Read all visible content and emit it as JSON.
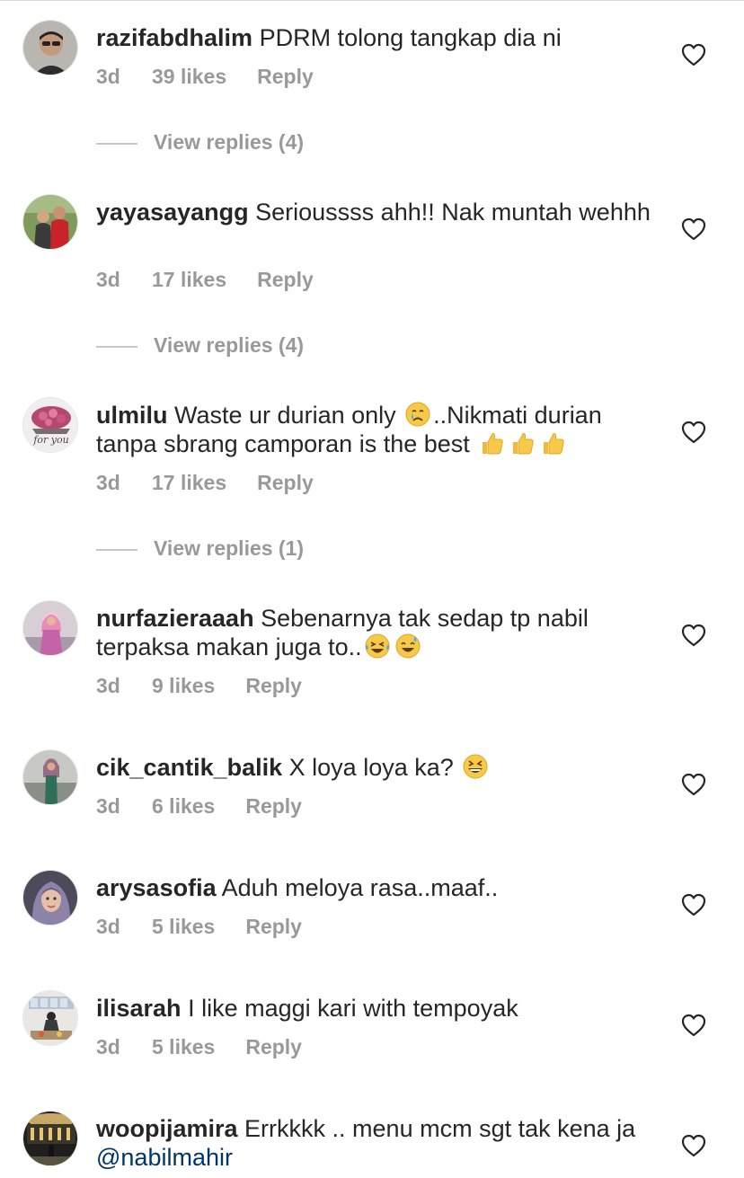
{
  "comments": [
    {
      "username": "razifabdhalim",
      "text": "PDRM tolong tangkap dia ni",
      "time": "3d",
      "likes": "39 likes",
      "reply": "Reply",
      "view_replies": "View replies (4)",
      "avatar": "avatar-man-glasses"
    },
    {
      "username": "yayasayangg",
      "text": "Serioussss ahh!! Nak muntah wehhh",
      "time": "3d",
      "likes": "17 likes",
      "reply": "Reply",
      "view_replies": "View replies (4)",
      "avatar": "avatar-couple"
    },
    {
      "username": "ulmilu",
      "text_part1": "Waste ur durian only",
      "text_part2": "..Nikmati durian tanpa sbrang camporan is the best",
      "emoji1": "crying-face",
      "emoji2": "thumbs-up x3",
      "time": "3d",
      "likes": "17 likes",
      "reply": "Reply",
      "view_replies": "View replies (1)",
      "avatar": "avatar-flowers-for-you",
      "avatar_text": "for you"
    },
    {
      "username": "nurfazieraaah",
      "text": "Sebenarnya tak sedap tp nabil terpaksa makan juga to..",
      "emoji": "laughing-tears, sweat-smile",
      "time": "3d",
      "likes": "9 likes",
      "reply": "Reply",
      "avatar": "avatar-pink-hijab"
    },
    {
      "username": "cik_cantik_balik",
      "text": "X loya loya ka?",
      "emoji": "grinning-squint",
      "time": "3d",
      "likes": "6 likes",
      "reply": "Reply",
      "avatar": "avatar-hijab-outdoor"
    },
    {
      "username": "arysasofia",
      "text": "Aduh meloya rasa..maaf..",
      "time": "3d",
      "likes": "5 likes",
      "reply": "Reply",
      "avatar": "avatar-hijab-selfie"
    },
    {
      "username": "ilisarah",
      "text": "I like maggi kari with tempoyak",
      "time": "3d",
      "likes": "5 likes",
      "reply": "Reply",
      "avatar": "avatar-kitchen"
    },
    {
      "username": "woopijamira",
      "text": "Errkkkk .. menu mcm sgt tak kena ja",
      "mention": "@nabilmahir",
      "avatar": "avatar-night-building"
    }
  ],
  "colors": {
    "text": "#262626",
    "meta": "#999999",
    "mention": "#003569",
    "heart": "#262626"
  },
  "icons": {
    "like": "heart-outline-icon"
  }
}
